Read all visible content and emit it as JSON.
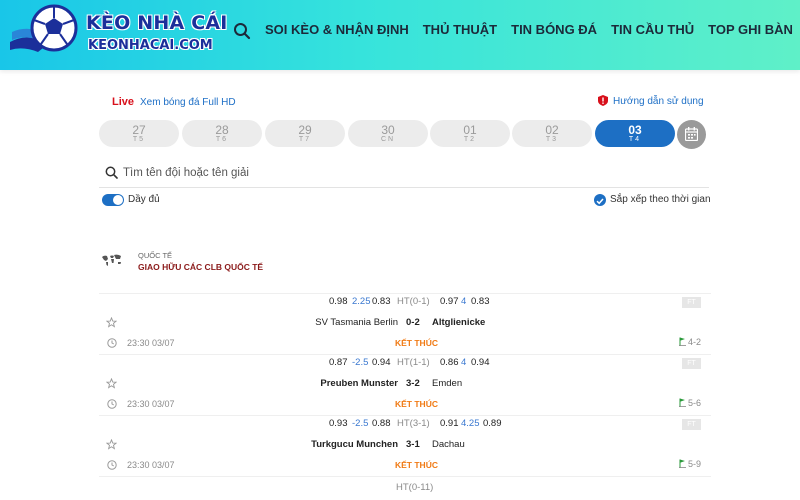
{
  "brand": {
    "title": "KÈO NHÀ CÁI",
    "subtitle": "KEONHACAI.COM"
  },
  "nav": [
    {
      "label": "SOI KÈO & NHẬN ĐỊNH"
    },
    {
      "label": "THỦ THUẬT"
    },
    {
      "label": "TIN BÓNG ĐÁ"
    },
    {
      "label": "TIN CẦU THỦ"
    },
    {
      "label": "TOP GHI BÀN"
    }
  ],
  "live": {
    "tag": "Live",
    "text": "Xem bóng đá Full HD"
  },
  "guide": {
    "text": "Hướng dẫn sử dụng"
  },
  "dates": [
    {
      "day": "27",
      "weekday": "T5"
    },
    {
      "day": "28",
      "weekday": "T6"
    },
    {
      "day": "29",
      "weekday": "T7"
    },
    {
      "day": "30",
      "weekday": "CN"
    },
    {
      "day": "01",
      "weekday": "T2"
    },
    {
      "day": "02",
      "weekday": "T3"
    },
    {
      "day": "03",
      "weekday": "T4",
      "active": true
    }
  ],
  "search": {
    "placeholder": "Tìm tên đội hoặc tên giải"
  },
  "filters": {
    "full_label": "Dầy đủ",
    "sort_label": "Sắp xếp theo thời gian"
  },
  "league": {
    "region": "QUỐC TẾ",
    "name": "GIAO HỮU CÁC CLB QUỐC TẾ"
  },
  "matches": [
    {
      "odds": {
        "h1": "0.98",
        "hcap": "2.25",
        "h2": "0.83",
        "ht": "HT(0-1)",
        "t1": "0.97",
        "total": "4",
        "t2": "0.83"
      },
      "ft": "FT",
      "home": "SV Tasmania Berlin",
      "score": "0-2",
      "away": "Altglienicke",
      "winner": "away",
      "time": "23:30 03/07",
      "status": "KẾT THÚC",
      "corners": "4-2"
    },
    {
      "odds": {
        "h1": "0.87",
        "hcap": "-2.5",
        "h2": "0.94",
        "ht": "HT(1-1)",
        "t1": "0.86",
        "total": "4",
        "t2": "0.94"
      },
      "ft": "FT",
      "home": "Preuben Munster",
      "score": "3-2",
      "away": "Emden",
      "winner": "home",
      "time": "23:30 03/07",
      "status": "KẾT THÚC",
      "corners": "5-6"
    },
    {
      "odds": {
        "h1": "0.93",
        "hcap": "-2.5",
        "h2": "0.88",
        "ht": "HT(3-1)",
        "t1": "0.91",
        "total": "4.25",
        "t2": "0.89"
      },
      "ft": "FT",
      "home": "Turkgucu Munchen",
      "score": "3-1",
      "away": "Dachau",
      "winner": "home",
      "time": "23:30 03/07",
      "status": "KẾT THÚC",
      "corners": "5-9"
    }
  ],
  "next_ht": "HT(0-11)",
  "colors": {
    "primary": "#1d6fc4",
    "live": "#d8101b",
    "status": "#f07a14",
    "league": "#8b1a1a",
    "odds_blue": "#3a78d0"
  }
}
